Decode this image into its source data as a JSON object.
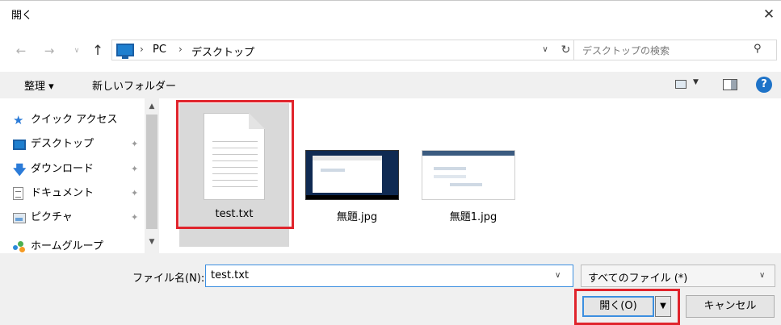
{
  "window": {
    "title": "開く",
    "close_glyph": "✕"
  },
  "nav": {
    "back_glyph": "←",
    "forward_glyph": "→",
    "recent_glyph": "∨",
    "up_glyph": "↑"
  },
  "address": {
    "crumbs": [
      "PC",
      "デスクトップ"
    ],
    "separator": "›",
    "dropdown_glyph": "∨",
    "refresh_glyph": "↻"
  },
  "search": {
    "placeholder": "デスクトップの検索",
    "icon_glyph": "⚲"
  },
  "toolbar": {
    "organize_label": "整理 ▾",
    "new_folder_label": "新しいフォルダー",
    "view_caret": "▼",
    "help_glyph": "?"
  },
  "sidebar": {
    "items": [
      {
        "label": "クイック アクセス",
        "icon": "star-icon",
        "pinned": false
      },
      {
        "label": "デスクトップ",
        "icon": "desktop-icon",
        "pinned": true
      },
      {
        "label": "ダウンロード",
        "icon": "download-icon",
        "pinned": true
      },
      {
        "label": "ドキュメント",
        "icon": "document-icon",
        "pinned": true
      },
      {
        "label": "ピクチャ",
        "icon": "pictures-icon",
        "pinned": true
      },
      {
        "label": "ホームグループ",
        "icon": "homegroup-icon",
        "pinned": false
      }
    ],
    "star_glyph": "★",
    "download_glyph": "🡇",
    "pin_glyph": "✦",
    "scroll_up_glyph": "▲",
    "scroll_down_glyph": "▼"
  },
  "files": [
    {
      "name": "test.txt",
      "type": "text-file",
      "selected": true
    },
    {
      "name": "無題.jpg",
      "type": "image-thumbnail",
      "selected": false
    },
    {
      "name": "無題1.jpg",
      "type": "image-thumbnail",
      "selected": false
    }
  ],
  "footer": {
    "filename_label": "ファイル名(N):",
    "filename_value": "test.txt",
    "filename_dropdown_glyph": "∨",
    "filter_value": "すべてのファイル (*)",
    "filter_dropdown_glyph": "∨",
    "open_label": "開く(O)",
    "open_split_glyph": "▼",
    "cancel_label": "キャンセル"
  },
  "colors": {
    "highlight": "#e0242c",
    "accent": "#3c8fe0",
    "selection": "#d9d9d9",
    "panel": "#f0f0f0"
  }
}
